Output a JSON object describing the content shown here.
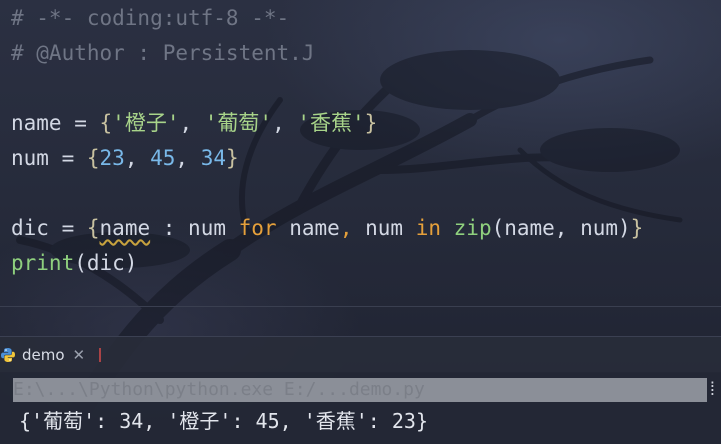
{
  "editor": {
    "comment_1": "# -*- coding:utf-8 -*-",
    "comment_2": "# @Author : Persistent.J",
    "line_name": {
      "var": "name",
      "op": " = ",
      "open": "{",
      "s1": "'橙子'",
      "s2": "'葡萄'",
      "s3": "'香蕉'",
      "close": "}"
    },
    "line_num": {
      "var": "num",
      "op": " = ",
      "open": "{",
      "n1": "23",
      "n2": "45",
      "n3": "34",
      "close": "}"
    },
    "line_dic": {
      "var": "dic",
      "op": " = ",
      "open": "{",
      "key": "name",
      "colon": " : ",
      "val": "num",
      "kw_for": "for",
      "t1": "name",
      "t2": "num",
      "kw_in": "in",
      "fn_zip": "zip",
      "args": "(name, num)",
      "close": "}"
    },
    "line_print": {
      "fn": "print",
      "args": "(dic)"
    }
  },
  "run": {
    "tab_label": "demo",
    "close_glyph": "✕"
  },
  "console": {
    "command": "E:\\...\\Python\\python.exe E:/...demo.py",
    "output": "{'葡萄': 34, '橙子': 45, '香蕉': 23}"
  },
  "colors": {
    "keyword": "#e5a03b",
    "string": "#a8d48a",
    "number": "#79b8e8",
    "comment": "#6f7585"
  }
}
